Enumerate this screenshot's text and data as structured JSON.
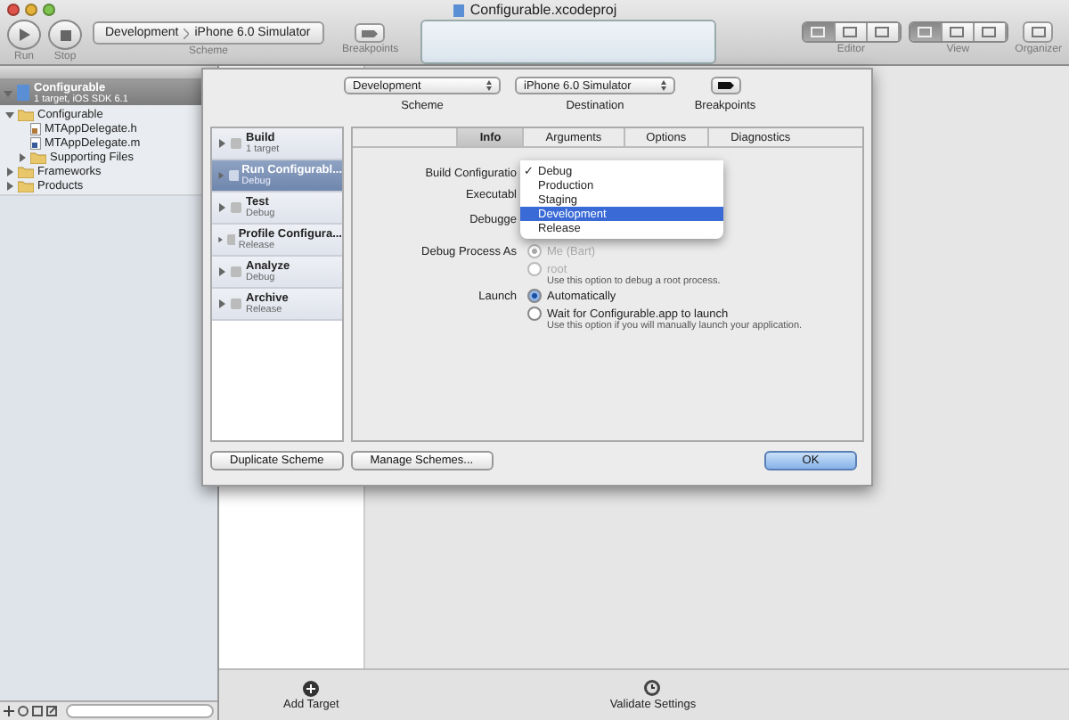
{
  "window": {
    "title": "Configurable.xcodeproj"
  },
  "toolbar": {
    "run": "Run",
    "stop": "Stop",
    "scheme_path": [
      "Development",
      "iPhone 6.0 Simulator"
    ],
    "scheme_label": "Scheme",
    "breakpoints_label": "Breakpoints",
    "editor_label": "Editor",
    "view_label": "View",
    "organizer_label": "Organizer",
    "editor_modes": [
      {
        "selected": true
      },
      {
        "selected": false
      },
      {
        "selected": false
      }
    ],
    "view_toggles": [
      {
        "on": true
      },
      {
        "on": false
      },
      {
        "on": false
      }
    ]
  },
  "navigator": {
    "project": {
      "name": "Configurable",
      "subtitle": "1 target, iOS SDK 6.1",
      "selected": true
    },
    "tree": [
      {
        "name": "Configurable",
        "kind": "folder",
        "expanded": true,
        "children": [
          {
            "name": "MTAppDelegate.h",
            "kind": "header"
          },
          {
            "name": "MTAppDelegate.m",
            "kind": "source"
          },
          {
            "name": "Supporting Files",
            "kind": "folder",
            "expanded": false
          }
        ]
      },
      {
        "name": "Frameworks",
        "kind": "folder",
        "expanded": false
      },
      {
        "name": "Products",
        "kind": "folder",
        "expanded": false
      }
    ]
  },
  "bottom_bar": {
    "actions": [
      "Add Target",
      "Validate Settings"
    ]
  },
  "sheet": {
    "scheme": "Development",
    "destination": "iPhone 6.0 Simulator",
    "labels": [
      "Scheme",
      "Destination",
      "Breakpoints"
    ],
    "actions": [
      {
        "title": "Build",
        "subtitle": "1 target",
        "selected": false
      },
      {
        "title": "Run Configurabl...",
        "subtitle": "Debug",
        "selected": true
      },
      {
        "title": "Test",
        "subtitle": "Debug",
        "selected": false
      },
      {
        "title": "Profile Configura...",
        "subtitle": "Release",
        "selected": false
      },
      {
        "title": "Analyze",
        "subtitle": "Debug",
        "selected": false
      },
      {
        "title": "Archive",
        "subtitle": "Release",
        "selected": false
      }
    ],
    "tabs": [
      {
        "label": "Info",
        "selected": true
      },
      {
        "label": "Arguments",
        "selected": false
      },
      {
        "label": "Options",
        "selected": false
      },
      {
        "label": "Diagnostics",
        "selected": false
      }
    ],
    "build_configuration_label": "Build Configuratio",
    "executable_label": "Executabl",
    "debugger_label": "Debugge",
    "menu": [
      {
        "label": "Debug",
        "checked": true,
        "selected": false
      },
      {
        "label": "Production",
        "checked": false,
        "selected": false
      },
      {
        "label": "Staging",
        "checked": false,
        "selected": false
      },
      {
        "label": "Development",
        "checked": false,
        "selected": true
      },
      {
        "label": "Release",
        "checked": false,
        "selected": false
      }
    ],
    "check_mark": "✓",
    "debug_process_as": {
      "label": "Debug Process As",
      "options": [
        {
          "label": "Me (Bart)",
          "selected": true,
          "disabled": true
        },
        {
          "label": "root",
          "hint": "Use this option to debug a root process.",
          "selected": false,
          "disabled": true
        }
      ]
    },
    "launch": {
      "label": "Launch",
      "options": [
        {
          "label": "Automatically",
          "selected": true,
          "disabled": false
        },
        {
          "label": "Wait for Configurable.app to launch",
          "hint": "Use this option if you will manually launch your application.",
          "selected": false,
          "disabled": false
        }
      ]
    },
    "buttons": [
      {
        "label": "Duplicate Scheme",
        "kind": "normal"
      },
      {
        "label": "Manage Schemes...",
        "kind": "normal"
      },
      {
        "label": "OK",
        "kind": "default"
      }
    ]
  }
}
